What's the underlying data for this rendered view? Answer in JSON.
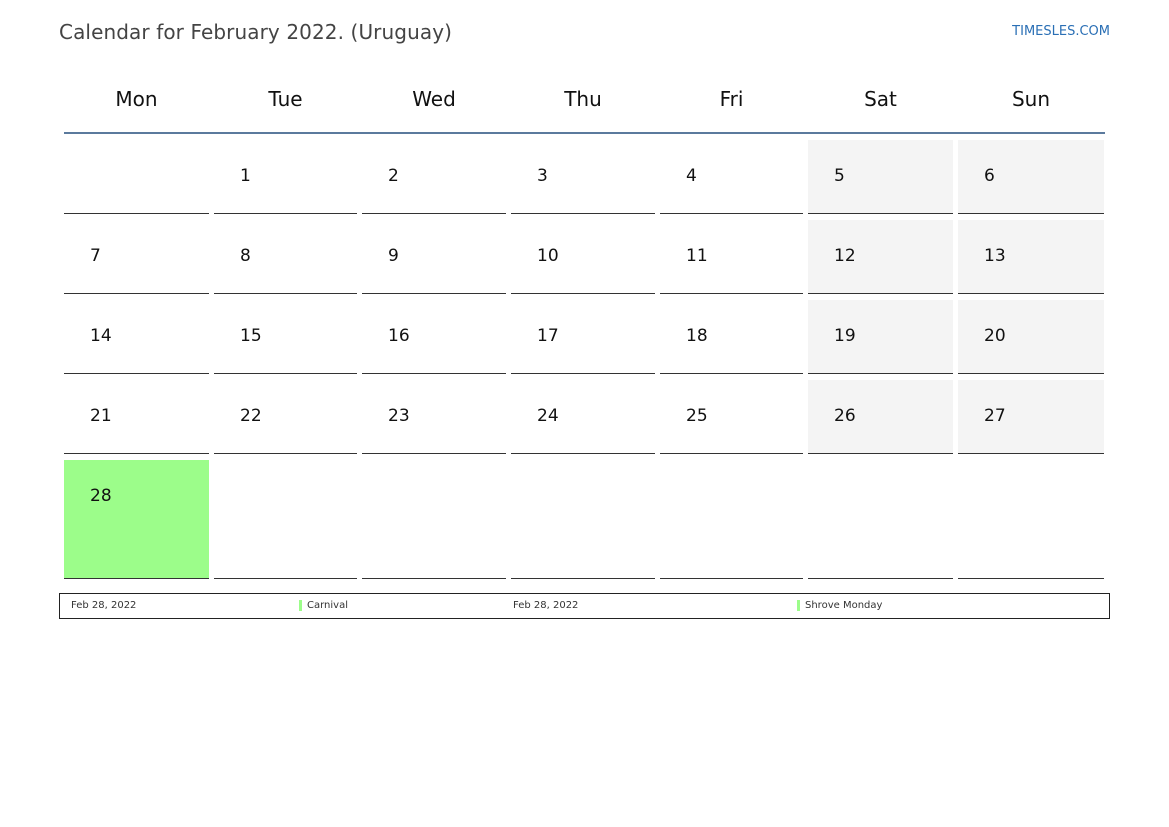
{
  "title": "Calendar for February 2022. (Uruguay)",
  "site": "TIMESLES.COM",
  "weekdays": [
    "Mon",
    "Tue",
    "Wed",
    "Thu",
    "Fri",
    "Sat",
    "Sun"
  ],
  "weeks": [
    [
      "",
      "1",
      "2",
      "3",
      "4",
      "5",
      "6"
    ],
    [
      "7",
      "8",
      "9",
      "10",
      "11",
      "12",
      "13"
    ],
    [
      "14",
      "15",
      "16",
      "17",
      "18",
      "19",
      "20"
    ],
    [
      "21",
      "22",
      "23",
      "24",
      "25",
      "26",
      "27"
    ],
    [
      "28",
      "",
      "",
      "",
      "",
      "",
      ""
    ]
  ],
  "holiday_color": "#9cfd8a",
  "weekend_color": "#f4f4f4",
  "holidays": [
    {
      "date": "Feb 28, 2022",
      "name": "Carnival"
    },
    {
      "date": "Feb 28, 2022",
      "name": "Shrove Monday"
    }
  ]
}
